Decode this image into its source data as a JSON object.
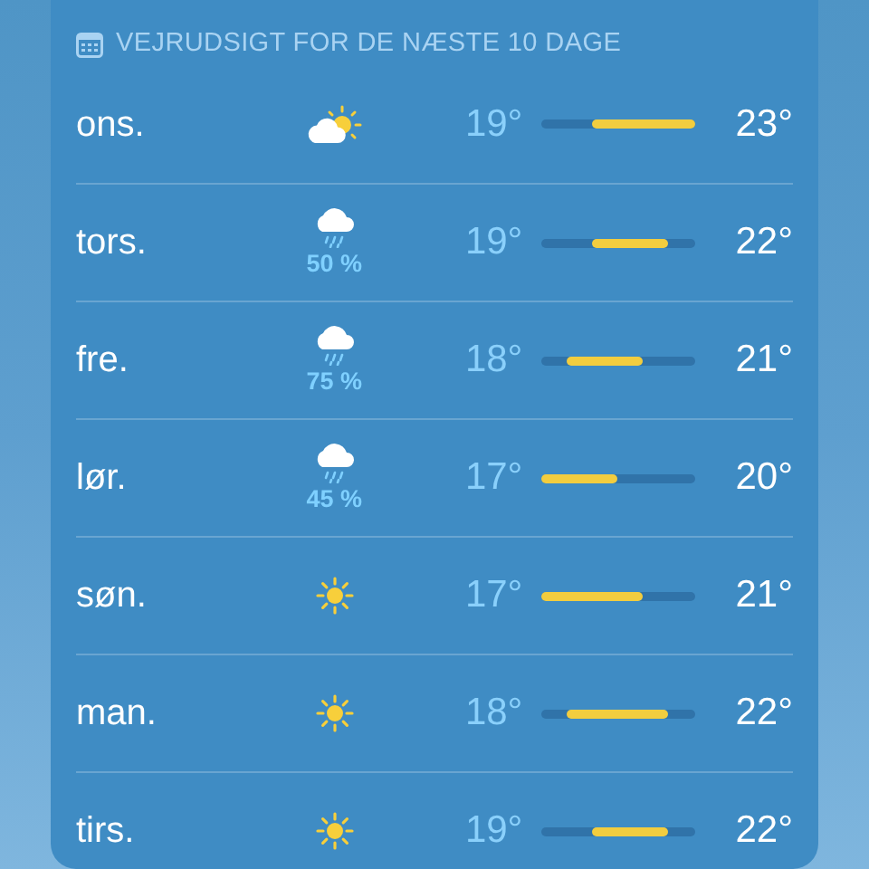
{
  "header": {
    "title": "VEJRUDSIGT FOR DE NÆSTE 10 DAGE"
  },
  "days": [
    {
      "day": "ons.",
      "kind": "partly-cloudy",
      "low": "19°",
      "high": "23°"
    },
    {
      "day": "tors.",
      "kind": "rain",
      "precipitation": "50 %",
      "low": "19°",
      "high": "22°"
    },
    {
      "day": "fre.",
      "kind": "rain",
      "precipitation": "75 %",
      "low": "18°",
      "high": "21°"
    },
    {
      "day": "lør.",
      "kind": "rain",
      "precipitation": "45 %",
      "low": "17°",
      "high": "20°"
    },
    {
      "day": "søn.",
      "kind": "sun",
      "low": "17°",
      "high": "21°"
    },
    {
      "day": "man.",
      "kind": "sun",
      "low": "18°",
      "high": "22°"
    },
    {
      "day": "tirs.",
      "kind": "sun",
      "low": "19°",
      "high": "22°"
    }
  ]
}
